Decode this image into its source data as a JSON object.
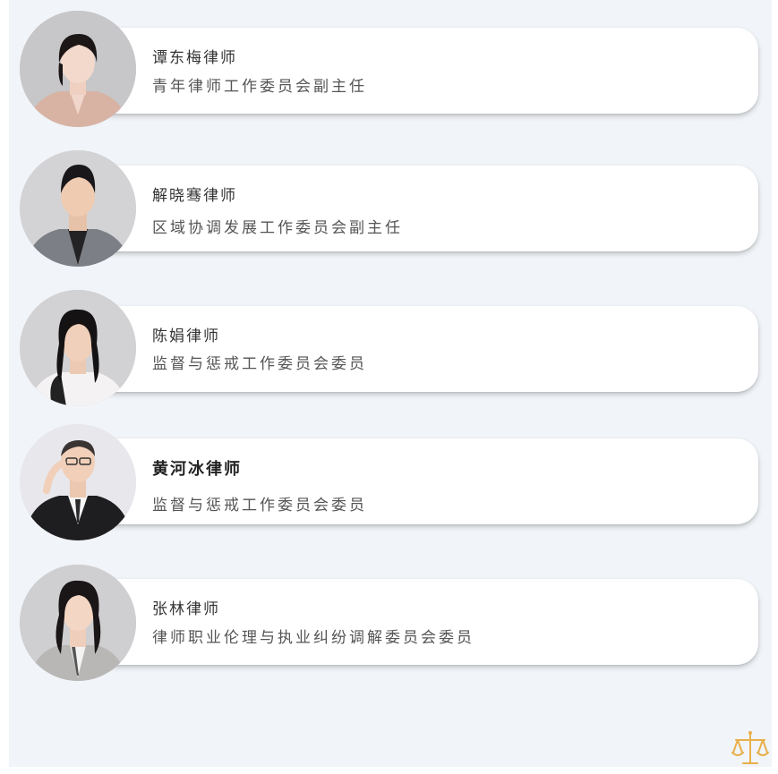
{
  "members": [
    {
      "name": "谭东梅律师",
      "title": "青年律师工作委员会副主任",
      "avatar_icon": "portrait-photo"
    },
    {
      "name": "解晓骞律师",
      "title": "区域协调发展工作委员会副主任",
      "avatar_icon": "portrait-photo"
    },
    {
      "name": "陈娟律师",
      "title": "监督与惩戒工作委员会委员",
      "avatar_icon": "portrait-photo"
    },
    {
      "name": "黄河冰律师",
      "title": "监督与惩戒工作委员会委员",
      "avatar_icon": "portrait-photo"
    },
    {
      "name": "张林律师",
      "title": "律师职业伦理与执业纠纷调解委员会委员",
      "avatar_icon": "portrait-photo"
    }
  ],
  "colors": {
    "page_background": "#f1f4f8",
    "card_background": "#ffffff",
    "logo_gold": "#e8b04a"
  },
  "logo_icon": "scales-of-justice-icon"
}
